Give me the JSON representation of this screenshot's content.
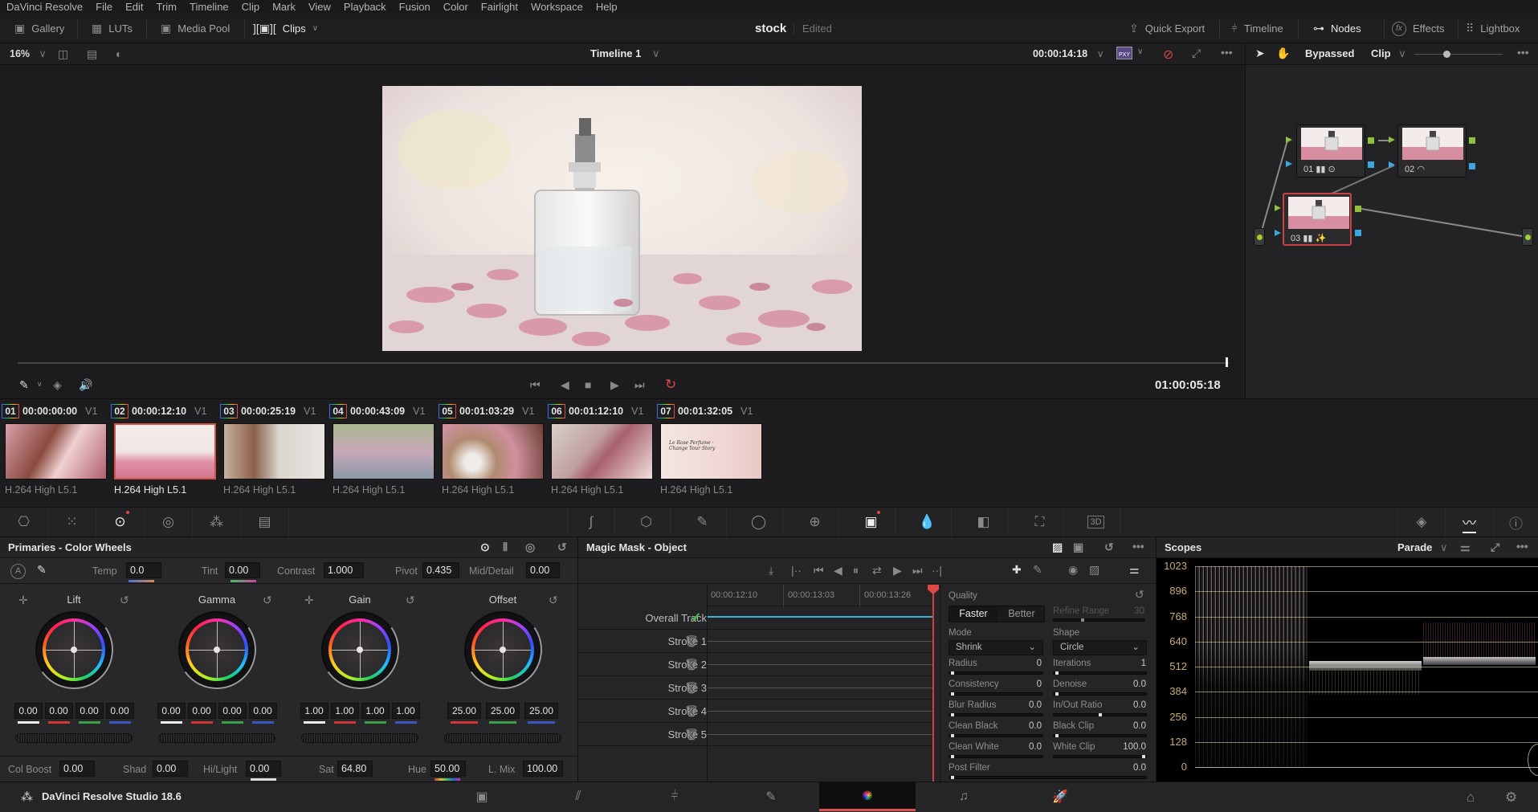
{
  "menu": [
    "DaVinci Resolve",
    "File",
    "Edit",
    "Trim",
    "Timeline",
    "Clip",
    "Mark",
    "View",
    "Playback",
    "Fusion",
    "Color",
    "Fairlight",
    "Workspace",
    "Help"
  ],
  "toolbar": {
    "left": [
      {
        "icon": "gallery-icon",
        "label": "Gallery"
      },
      {
        "icon": "luts-icon",
        "label": "LUTs"
      },
      {
        "icon": "media-pool-icon",
        "label": "Media Pool"
      },
      {
        "icon": "clips-icon",
        "label": "Clips"
      }
    ],
    "project_name": "stock",
    "project_status": "Edited",
    "right": [
      {
        "icon": "quick-export-icon",
        "label": "Quick Export"
      },
      {
        "icon": "timeline-icon",
        "label": "Timeline"
      },
      {
        "icon": "nodes-icon",
        "label": "Nodes"
      },
      {
        "icon": "effects-icon",
        "label": "Effects"
      },
      {
        "icon": "lightbox-icon",
        "label": "Lightbox"
      }
    ]
  },
  "viewer": {
    "zoom": "16%",
    "timeline_name": "Timeline 1",
    "source_timecode": "00:00:14:18",
    "proxy_badge": "PXY",
    "playhead_timecode": "01:00:05:18",
    "scrub_position": 0.999
  },
  "node_editor": {
    "bypass_label": "Bypassed",
    "mode": "Clip",
    "nodes": [
      {
        "id": "01",
        "tools": [
          "histogram-icon",
          "circle-window-icon"
        ]
      },
      {
        "id": "02",
        "tools": [
          "hdr-icon"
        ]
      },
      {
        "id": "03",
        "tools": [
          "histogram-icon",
          "magic-mask-icon"
        ],
        "selected": true
      }
    ]
  },
  "clips": [
    {
      "num": "01",
      "tc": "00:00:00:00",
      "track": "V1",
      "codec": "H.264 High L5.1"
    },
    {
      "num": "02",
      "tc": "00:00:12:10",
      "track": "V1",
      "codec": "H.264 High L5.1",
      "selected": true
    },
    {
      "num": "03",
      "tc": "00:00:25:19",
      "track": "V1",
      "codec": "H.264 High L5.1"
    },
    {
      "num": "04",
      "tc": "00:00:43:09",
      "track": "V1",
      "codec": "H.264 High L5.1"
    },
    {
      "num": "05",
      "tc": "00:01:03:29",
      "track": "V1",
      "codec": "H.264 High L5.1"
    },
    {
      "num": "06",
      "tc": "00:01:12:10",
      "track": "V1",
      "codec": "H.264 High L5.1"
    },
    {
      "num": "07",
      "tc": "00:01:32:05",
      "track": "V1",
      "codec": "H.264 High L5.1"
    }
  ],
  "clip7_overlay": "Le Rose Perfume · Change Your Story",
  "primaries": {
    "title": "Primaries - Color Wheels",
    "auto_label": "A",
    "temp_label": "Temp",
    "temp": "0.0",
    "tint_label": "Tint",
    "tint": "0.00",
    "contrast_label": "Contrast",
    "contrast": "1.000",
    "pivot_label": "Pivot",
    "pivot": "0.435",
    "middetail_label": "Mid/Detail",
    "middetail": "0.00",
    "wheels": [
      {
        "name": "Lift",
        "values": [
          "0.00",
          "0.00",
          "0.00",
          "0.00"
        ]
      },
      {
        "name": "Gamma",
        "values": [
          "0.00",
          "0.00",
          "0.00",
          "0.00"
        ]
      },
      {
        "name": "Gain",
        "values": [
          "1.00",
          "1.00",
          "1.00",
          "1.00"
        ]
      },
      {
        "name": "Offset",
        "values": [
          "25.00",
          "25.00",
          "25.00"
        ]
      }
    ],
    "colboost_label": "Col Boost",
    "colboost": "0.00",
    "shad_label": "Shad",
    "shad": "0.00",
    "hilight_label": "Hi/Light",
    "hilight": "0.00",
    "sat_label": "Sat",
    "sat": "64.80",
    "hue_label": "Hue",
    "hue": "50.00",
    "lmix_label": "L. Mix",
    "lmix": "100.00"
  },
  "magic_mask": {
    "title": "Magic Mask - Object",
    "ruler": [
      "00:00:12:10",
      "00:00:13:03",
      "00:00:13:26"
    ],
    "tracks": [
      {
        "name": "Overall Track",
        "status": "check"
      },
      {
        "name": "Stroke 1"
      },
      {
        "name": "Stroke 2"
      },
      {
        "name": "Stroke 3"
      },
      {
        "name": "Stroke 4"
      },
      {
        "name": "Stroke 5"
      }
    ],
    "quality_label": "Quality",
    "quality_options": [
      "Faster",
      "Better"
    ],
    "quality_selected": "Faster",
    "refine_range_label": "Refine Range",
    "refine_range": "30",
    "mode_label": "Mode",
    "mode": "Shrink",
    "shape_label": "Shape",
    "shape": "Circle",
    "params": [
      {
        "label": "Radius",
        "value": "0"
      },
      {
        "label": "Iterations",
        "value": "1"
      },
      {
        "label": "Consistency",
        "value": "0"
      },
      {
        "label": "Denoise",
        "value": "0.0"
      },
      {
        "label": "Blur Radius",
        "value": "0.0"
      },
      {
        "label": "In/Out Ratio",
        "value": "0.0"
      },
      {
        "label": "Clean Black",
        "value": "0.0"
      },
      {
        "label": "Black Clip",
        "value": "0.0"
      },
      {
        "label": "Clean White",
        "value": "0.0"
      },
      {
        "label": "White Clip",
        "value": "100.0"
      }
    ],
    "post_filter_label": "Post Filter",
    "post_filter": "0.0"
  },
  "scopes": {
    "title": "Scopes",
    "type": "Parade",
    "scale": [
      "1023",
      "896",
      "768",
      "640",
      "512",
      "384",
      "256",
      "128",
      "0"
    ]
  },
  "app_footer": {
    "product": "DaVinci Resolve Studio 18.6",
    "pages": [
      "media-page-icon",
      "cut-page-icon",
      "edit-page-icon",
      "fusion-page-icon",
      "color-page-icon",
      "fairlight-page-icon",
      "deliver-page-icon"
    ],
    "active_page": "color-page-icon"
  },
  "colors": {
    "accent_red": "#d85050",
    "selection_red": "#d25245",
    "track_blue": "#39b4d6",
    "check_green": "#3cc24a",
    "scope_label": "#c8ad74"
  }
}
